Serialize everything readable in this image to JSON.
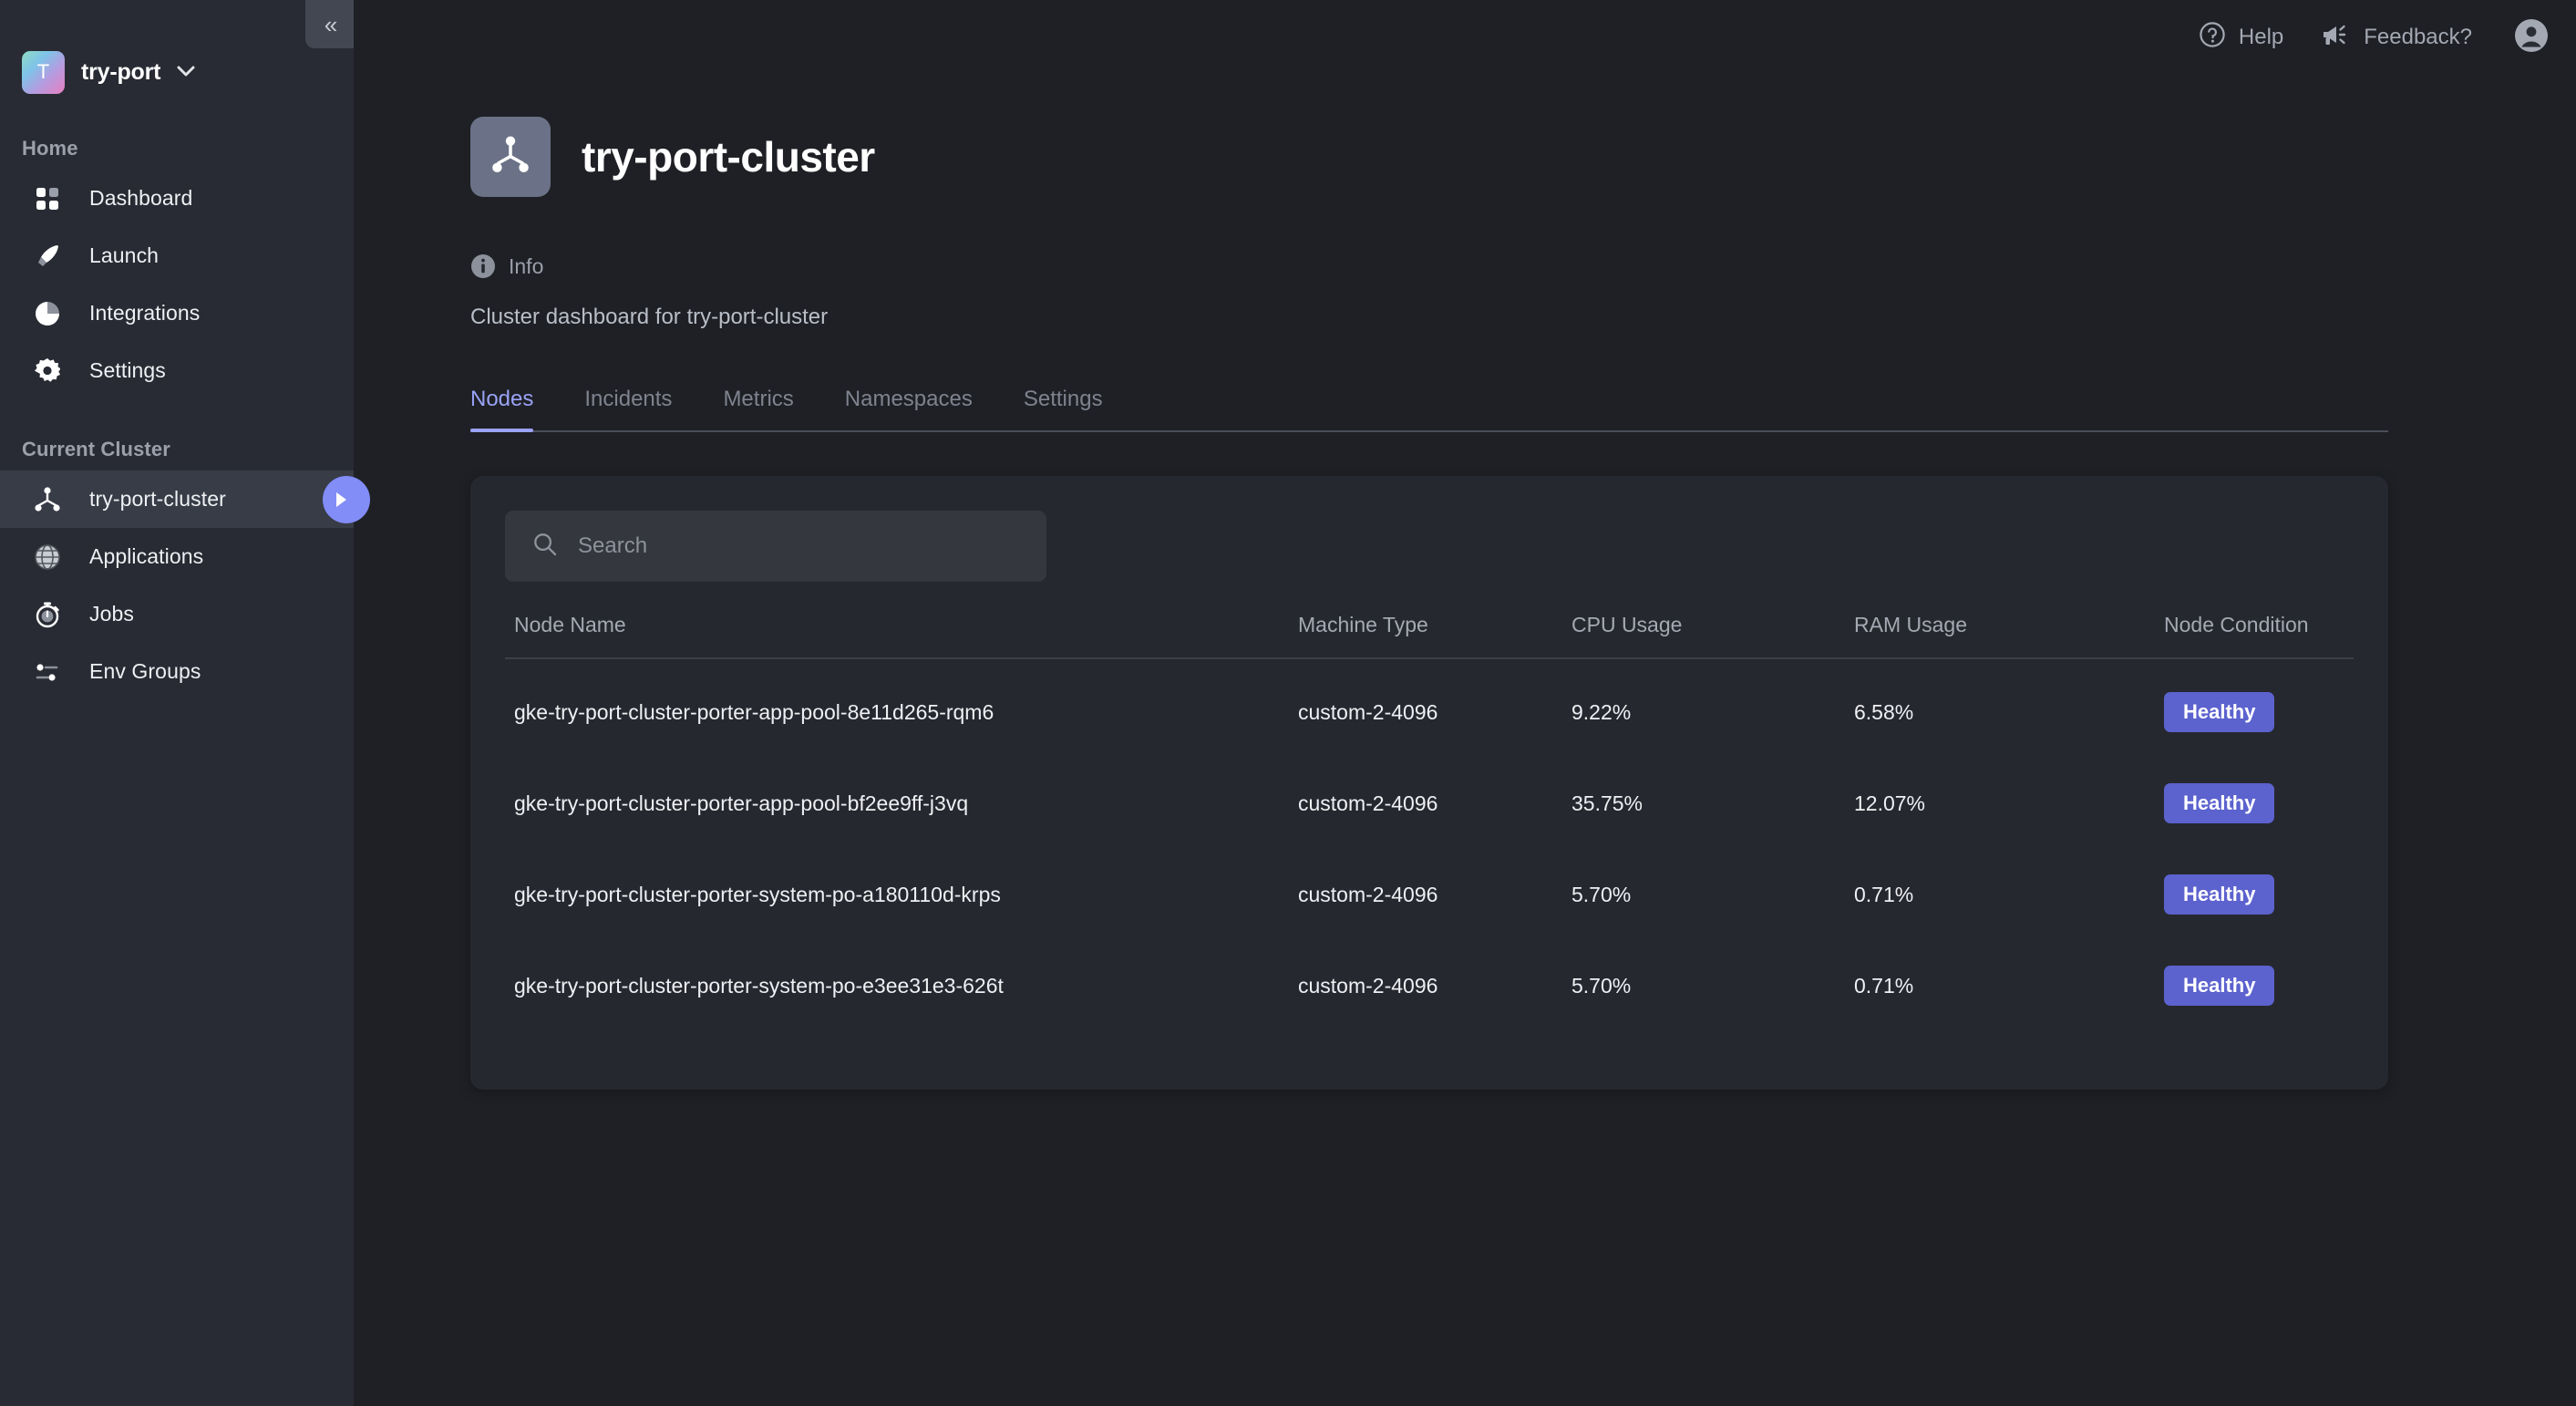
{
  "sidebar": {
    "collapse_icon": "chevron-double-left-icon",
    "collapse_glyph": "«",
    "org": {
      "avatar_letter": "T",
      "name": "try-port",
      "caret_glyph": "▼"
    },
    "sections": [
      {
        "label": "Home",
        "items": [
          {
            "label": "Dashboard",
            "icon": "grid-icon",
            "active": false
          },
          {
            "label": "Launch",
            "icon": "rocket-icon",
            "active": false
          },
          {
            "label": "Integrations",
            "icon": "pie-chart-icon",
            "active": false
          },
          {
            "label": "Settings",
            "icon": "gear-icon",
            "active": false
          }
        ]
      },
      {
        "label": "Current Cluster",
        "items": [
          {
            "label": "try-port-cluster",
            "icon": "cluster-nodes-icon",
            "active": true,
            "go_icon": "arrow-right-icon"
          },
          {
            "label": "Applications",
            "icon": "globe-icon",
            "active": false
          },
          {
            "label": "Jobs",
            "icon": "stopwatch-icon",
            "active": false
          },
          {
            "label": "Env Groups",
            "icon": "sliders-icon",
            "active": false
          }
        ]
      }
    ]
  },
  "topbar": {
    "help": {
      "label": "Help",
      "icon": "help-circle-icon"
    },
    "feedback": {
      "label": "Feedback?",
      "icon": "megaphone-icon"
    },
    "account": {
      "icon": "user-avatar-icon"
    }
  },
  "page": {
    "icon": "cluster-nodes-icon",
    "title": "try-port-cluster",
    "info_icon": "info-icon",
    "info_label": "Info",
    "description": "Cluster dashboard for try-port-cluster"
  },
  "tabs": [
    {
      "label": "Nodes",
      "active": true
    },
    {
      "label": "Incidents",
      "active": false
    },
    {
      "label": "Metrics",
      "active": false
    },
    {
      "label": "Namespaces",
      "active": false
    },
    {
      "label": "Settings",
      "active": false
    }
  ],
  "search": {
    "icon": "search-icon",
    "value": "",
    "placeholder": "Search"
  },
  "table": {
    "columns": [
      "Node Name",
      "Machine Type",
      "CPU Usage",
      "RAM Usage",
      "Node Condition"
    ],
    "rows": [
      {
        "node_name": "gke-try-port-cluster-porter-app-pool-8e11d265-rqm6",
        "machine_type": "custom-2-4096",
        "cpu_usage": "9.22%",
        "ram_usage": "6.58%",
        "condition": "Healthy"
      },
      {
        "node_name": "gke-try-port-cluster-porter-app-pool-bf2ee9ff-j3vq",
        "machine_type": "custom-2-4096",
        "cpu_usage": "35.75%",
        "ram_usage": "12.07%",
        "condition": "Healthy"
      },
      {
        "node_name": "gke-try-port-cluster-porter-system-po-a180110d-krps",
        "machine_type": "custom-2-4096",
        "cpu_usage": "5.70%",
        "ram_usage": "0.71%",
        "condition": "Healthy"
      },
      {
        "node_name": "gke-try-port-cluster-porter-system-po-e3ee31e3-626t",
        "machine_type": "custom-2-4096",
        "cpu_usage": "5.70%",
        "ram_usage": "0.71%",
        "condition": "Healthy"
      }
    ]
  },
  "colors": {
    "sidebar_bg": "#282b33",
    "main_bg": "#1e2025",
    "card_bg": "#26282f",
    "accent": "#9aa2f5",
    "badge_healthy": "#5c62ce",
    "go_button": "#828df8",
    "active_nav_bg": "#383c47"
  }
}
